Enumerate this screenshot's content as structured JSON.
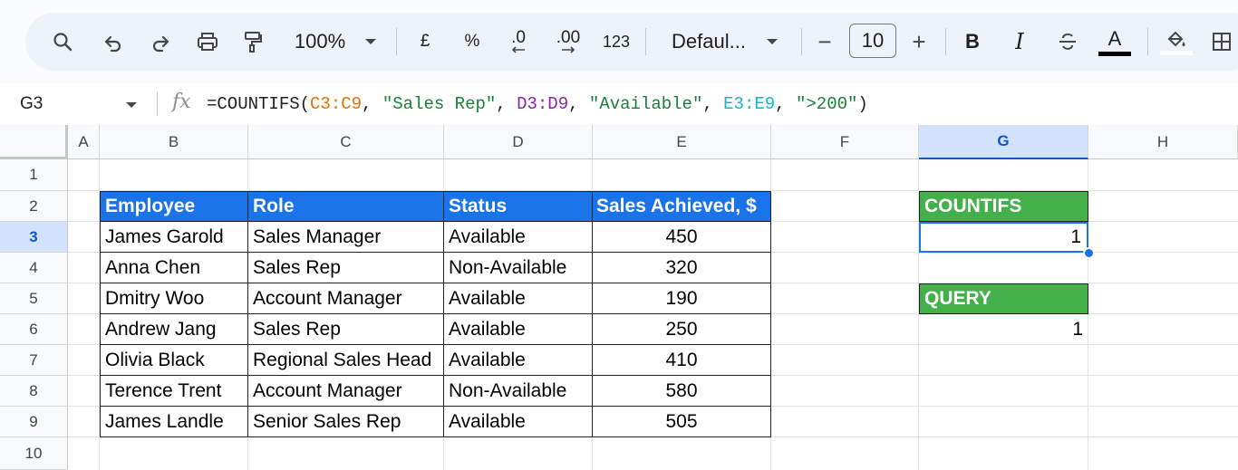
{
  "toolbar": {
    "zoom": "100%",
    "currency": "£",
    "percent": "%",
    "decrease_decimal": ".0",
    "increase_decimal": ".00",
    "number_format": "123",
    "font": "Defaul...",
    "font_size": "10",
    "minus": "−",
    "plus": "+",
    "bold": "B",
    "italic": "I",
    "text_color_letter": "A",
    "colors": {
      "text_color_bar": "#000000",
      "fill_color_bar": "#ffffff"
    }
  },
  "formula_bar": {
    "cell_ref": "G3",
    "fx": "fx",
    "formula_parts": [
      {
        "text": "=COUNTIFS(",
        "color": "#1f1f1f"
      },
      {
        "text": "C3:C9",
        "color": "#e37400"
      },
      {
        "text": ", ",
        "color": "#1f1f1f"
      },
      {
        "text": "\"Sales Rep\"",
        "color": "#188038"
      },
      {
        "text": ", ",
        "color": "#1f1f1f"
      },
      {
        "text": "D3:D9",
        "color": "#8e24aa"
      },
      {
        "text": ", ",
        "color": "#1f1f1f"
      },
      {
        "text": "\"Available\"",
        "color": "#188038"
      },
      {
        "text": ", ",
        "color": "#1f1f1f"
      },
      {
        "text": "E3:E9",
        "color": "#12b5cb"
      },
      {
        "text": ", ",
        "color": "#1f1f1f"
      },
      {
        "text": "\">200\"",
        "color": "#188038"
      },
      {
        "text": ")",
        "color": "#1f1f1f"
      }
    ]
  },
  "columns": [
    "A",
    "B",
    "C",
    "D",
    "E",
    "F",
    "G",
    "H"
  ],
  "selected_column": "G",
  "rows": [
    "1",
    "2",
    "3",
    "4",
    "5",
    "6",
    "7",
    "8",
    "9",
    "10"
  ],
  "selected_row": "3",
  "table": {
    "headers": [
      "Employee",
      "Role",
      "Status",
      "Sales Achieved, $"
    ],
    "rows": [
      [
        "James Garold",
        "Sales Manager",
        "Available",
        "450"
      ],
      [
        "Anna Chen",
        "Sales Rep",
        "Non-Available",
        "320"
      ],
      [
        "Dmitry Woo",
        "Account Manager",
        "Available",
        "190"
      ],
      [
        "Andrew Jang",
        "Sales Rep",
        "Available",
        "250"
      ],
      [
        "Olivia Black",
        "Regional Sales Head",
        "Available",
        "410"
      ],
      [
        "Terence Trent",
        "Account Manager",
        "Non-Available",
        "580"
      ],
      [
        "James Landle",
        "Senior Sales Rep",
        "Available",
        "505"
      ]
    ],
    "header_color": "#1a73e8"
  },
  "results": {
    "countifs_label": "COUNTIFS",
    "countifs_value": "1",
    "query_label": "QUERY",
    "query_value": "1",
    "label_color": "#43b049"
  }
}
